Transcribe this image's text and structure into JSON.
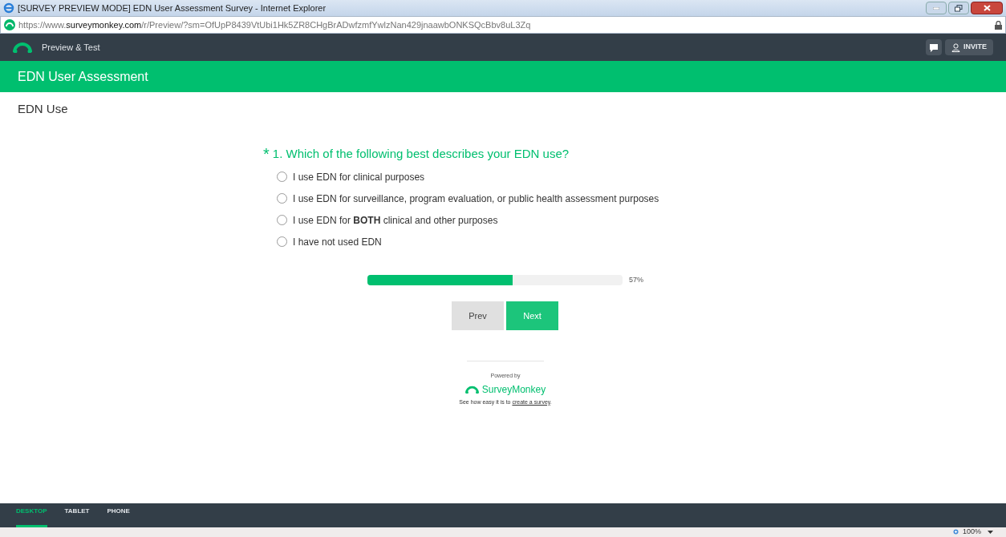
{
  "window": {
    "title": "[SURVEY PREVIEW MODE] EDN User Assessment Survey - Internet Explorer"
  },
  "address_bar": {
    "url_prefix": "https://www.",
    "url_domain": "surveymonkey.com",
    "url_path": "/r/Preview/?sm=OfUpP8439VtUbi1Hk5ZR8CHgBrADwfzmfYwlzNan429jnaawbONKSQcBbv8uL3Zq"
  },
  "toolbar": {
    "title": "Preview & Test",
    "invite_button": "INVITE"
  },
  "survey": {
    "title": "EDN User Assessment",
    "page_title": "EDN Use",
    "question": {
      "required_mark": "*",
      "text": "1. Which of the following best describes your EDN use?",
      "options": [
        {
          "label": "I use EDN for clinical purposes",
          "selected": false
        },
        {
          "label": "I use EDN for surveillance, program evaluation, or public health assessment purposes",
          "selected": false
        },
        {
          "label": "I use EDN for **BOTH** clinical and other purposes",
          "selected": false
        },
        {
          "label": "I have not used EDN",
          "selected": false
        }
      ]
    },
    "progress": {
      "level": 0.57,
      "reading": "57%"
    },
    "buttons": [
      "Prev",
      "Next"
    ]
  },
  "footer": {
    "powered_by": "Powered by",
    "brand": "SurveyMonkey",
    "tagline": "See how easy it is to",
    "link": "create a survey",
    "after_link": "."
  },
  "device_tabs": [
    {
      "label": "DESKTOP",
      "selected": true
    },
    {
      "label": "TABLET",
      "selected": false
    },
    {
      "label": "PHONE",
      "selected": false
    }
  ],
  "status_bar": {
    "zoom": "100%"
  }
}
